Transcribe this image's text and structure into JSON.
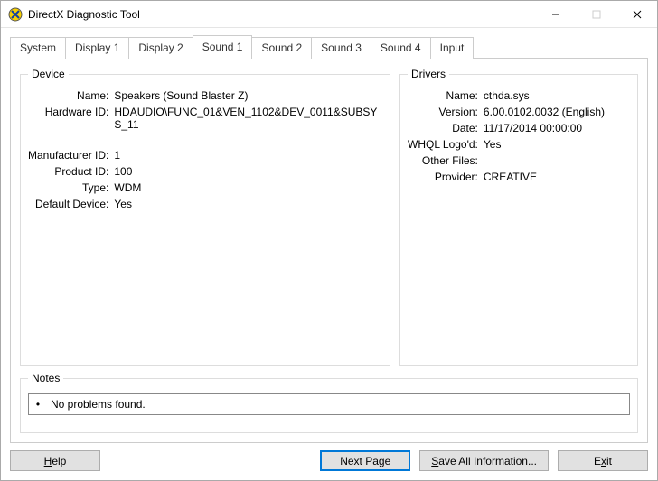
{
  "window": {
    "title": "DirectX Diagnostic Tool"
  },
  "tabs": [
    {
      "label": "System"
    },
    {
      "label": "Display 1"
    },
    {
      "label": "Display 2"
    },
    {
      "label": "Sound 1",
      "active": true
    },
    {
      "label": "Sound 2"
    },
    {
      "label": "Sound 3"
    },
    {
      "label": "Sound 4"
    },
    {
      "label": "Input"
    }
  ],
  "device": {
    "legend": "Device",
    "fields": {
      "name_label": "Name:",
      "name_value": "Speakers (Sound Blaster Z)",
      "hardware_id_label": "Hardware ID:",
      "hardware_id_value": "HDAUDIO\\FUNC_01&VEN_1102&DEV_0011&SUBSYS_11",
      "manufacturer_id_label": "Manufacturer ID:",
      "manufacturer_id_value": "1",
      "product_id_label": "Product ID:",
      "product_id_value": "100",
      "type_label": "Type:",
      "type_value": "WDM",
      "default_device_label": "Default Device:",
      "default_device_value": "Yes"
    }
  },
  "drivers": {
    "legend": "Drivers",
    "fields": {
      "name_label": "Name:",
      "name_value": "cthda.sys",
      "version_label": "Version:",
      "version_value": "6.00.0102.0032 (English)",
      "date_label": "Date:",
      "date_value": "11/17/2014 00:00:00",
      "whql_label": "WHQL Logo'd:",
      "whql_value": "Yes",
      "other_files_label": "Other Files:",
      "other_files_value": "",
      "provider_label": "Provider:",
      "provider_value": "CREATIVE"
    }
  },
  "notes": {
    "legend": "Notes",
    "items": [
      "No problems found."
    ]
  },
  "buttons": {
    "help": "Help",
    "next_page": "Next Page",
    "save_all": "Save All Information...",
    "exit": "Exit"
  }
}
